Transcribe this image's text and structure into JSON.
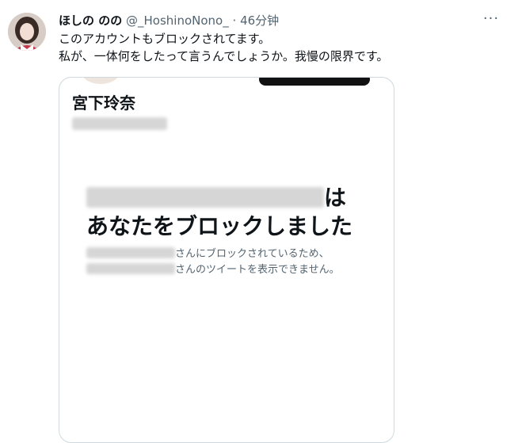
{
  "tweet": {
    "author_name": "ほしの のの",
    "author_handle": "@_HoshinoNono_",
    "separator": "·",
    "time": "46分钟",
    "more_icon": "ellipsis-icon",
    "text_line1": "このアカウントもブロックされてます。",
    "text_line2": "私が、一体何をしたって言うんでしょうか。我慢の限界です。"
  },
  "card": {
    "profile_name": "宮下玲奈",
    "blocked_title_suffix": "は",
    "blocked_title_line2": "あなたをブロックしました",
    "blocked_sub_line1_suffix": "さんにブロックされているため、",
    "blocked_sub_line2_suffix": "さんのツイートを表示できません。"
  },
  "colors": {
    "text_primary": "#0f1419",
    "text_secondary": "#536471",
    "border": "#cfd9de"
  }
}
